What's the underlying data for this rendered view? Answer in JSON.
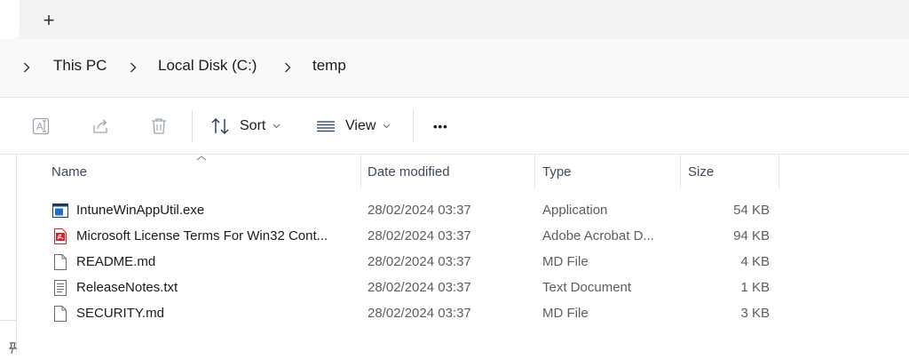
{
  "tabs": {
    "new_tab_glyph": "+"
  },
  "breadcrumb": [
    {
      "label": "This PC"
    },
    {
      "label": "Local Disk (C:)"
    },
    {
      "label": "temp"
    }
  ],
  "toolbar": {
    "sort_label": "Sort",
    "view_label": "View",
    "more_glyph": "•••"
  },
  "columns": {
    "name": "Name",
    "date": "Date modified",
    "type": "Type",
    "size": "Size"
  },
  "files": [
    {
      "name": "IntuneWinAppUtil.exe",
      "date": "28/02/2024 03:37",
      "type": "Application",
      "size": "54 KB",
      "icon": "exe-icon"
    },
    {
      "name": "Microsoft License Terms For Win32 Cont...",
      "date": "28/02/2024 03:37",
      "type": "Adobe Acrobat D...",
      "size": "94 KB",
      "icon": "pdf-icon"
    },
    {
      "name": "README.md",
      "date": "28/02/2024 03:37",
      "type": "MD File",
      "size": "4 KB",
      "icon": "file-icon"
    },
    {
      "name": "ReleaseNotes.txt",
      "date": "28/02/2024 03:37",
      "type": "Text Document",
      "size": "1 KB",
      "icon": "text-file-icon"
    },
    {
      "name": "SECURITY.md",
      "date": "28/02/2024 03:37",
      "type": "MD File",
      "size": "3 KB",
      "icon": "file-icon"
    }
  ],
  "colors": {
    "pdf_red": "#d3242b",
    "exe_blue": "#1a6fd1",
    "toolbar_disabled": "#9aa6b4"
  }
}
